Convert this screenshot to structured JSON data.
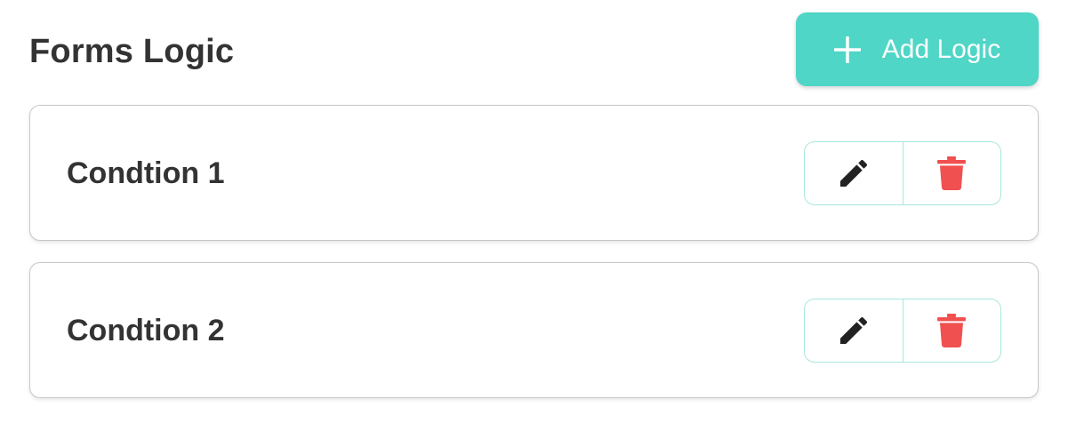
{
  "header": {
    "title": "Forms Logic",
    "add_button_label": "Add Logic",
    "add_button_icon": "plus-icon",
    "accent_color": "#4fd6c6"
  },
  "conditions": [
    {
      "label": "Condtion 1",
      "edit_icon": "pencil-icon",
      "delete_icon": "trash-icon"
    },
    {
      "label": "Condtion 2",
      "edit_icon": "pencil-icon",
      "delete_icon": "trash-icon"
    }
  ],
  "colors": {
    "delete": "#f0504f",
    "edit": "#222222",
    "button_border": "#a8e6de"
  }
}
